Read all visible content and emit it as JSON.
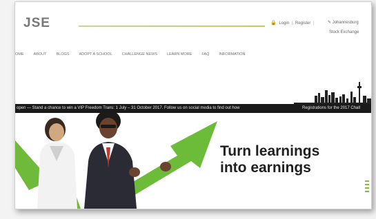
{
  "header": {
    "logo": "JSE",
    "login_label": "Login",
    "register_label": "Register",
    "location_label": "Johannesburg",
    "stock_exchange_label": "Stock Exchange"
  },
  "nav": {
    "items": [
      "OME",
      "ABOUT",
      "BLOGS",
      "ADOPT A SCHOOL",
      "CHALLENGE NEWS",
      "LEARN MORE",
      "FAQ",
      "INFORMATION"
    ]
  },
  "ticker": {
    "text_left": "open — Stand a chance to win a VIP Freedom Trans: 1 July – 31 October 2017. Follow us on social media to find out how",
    "text_right": "Registrations for the 2017 Chall"
  },
  "hero": {
    "headline_line1": "Turn learnings",
    "headline_line2": "into earnings"
  },
  "colors": {
    "accent_green": "#7fbf3f",
    "ticker_bg": "#1a1a1a"
  }
}
